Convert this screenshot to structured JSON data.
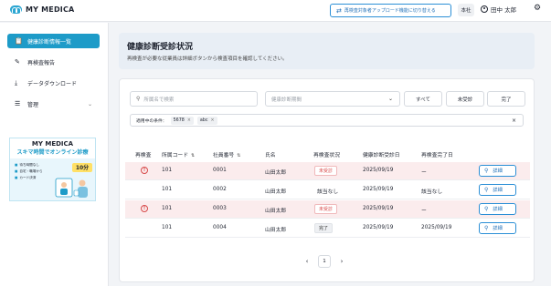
{
  "header": {
    "brand": "MY MEDICA",
    "switch_button": "再検査対象者アップロード機能に切り替える",
    "office": "本社",
    "user_name": "田中 太郎"
  },
  "sidebar": {
    "items": [
      {
        "label": "健康診断情報一覧",
        "icon": "clipboard-icon",
        "active": true
      },
      {
        "label": "再検査報告",
        "icon": "report-icon",
        "active": false
      },
      {
        "label": "データダウンロード",
        "icon": "download-icon",
        "active": false
      },
      {
        "label": "管理",
        "icon": "settings-icon",
        "active": false
      }
    ],
    "banner": {
      "brand": "MY MEDICA",
      "tagline": "スキマ時間でオンライン診療",
      "points": [
        "待ち時間なし",
        "自宅・職場から",
        "カード決済"
      ],
      "badge": "10分"
    }
  },
  "main": {
    "title": "健康診断受診状況",
    "description": "再検査が必要な従業員は詳細ボタンから検査項目を確認してください。",
    "search_placeholder": "所属名で検索",
    "period_placeholder": "健康診断期間",
    "segments": [
      "すべて",
      "未受診",
      "完了"
    ],
    "filter_label": "適用中の条件：",
    "chips": [
      "5678",
      "abc"
    ],
    "columns": [
      "再検査",
      "所属コード",
      "社員番号",
      "氏名",
      "再検査状況",
      "健康診断受診日",
      "再検査完了日"
    ],
    "rows": [
      {
        "alert": true,
        "dept": "101",
        "emp": "0001",
        "name": "山田太郎",
        "status": "未受診",
        "status_kind": "todo",
        "exam_date": "2025/09/19",
        "done_date": "ー",
        "action": "詳細"
      },
      {
        "alert": false,
        "dept": "101",
        "emp": "0002",
        "name": "山田太郎",
        "status": "該当なし",
        "status_kind": "none",
        "exam_date": "2025/09/19",
        "done_date": "該当なし",
        "action": "詳細"
      },
      {
        "alert": true,
        "dept": "101",
        "emp": "0003",
        "name": "山田太郎",
        "status": "未受診",
        "status_kind": "todo",
        "exam_date": "2025/09/19",
        "done_date": "ー",
        "action": "詳細"
      },
      {
        "alert": false,
        "dept": "101",
        "emp": "0004",
        "name": "山田太郎",
        "status": "完了",
        "status_kind": "done",
        "exam_date": "2025/09/19",
        "done_date": "2025/09/19",
        "action": "詳細"
      }
    ],
    "pagination": {
      "current": "1"
    }
  },
  "colors": {
    "accent": "#1d9bc8",
    "alert_row": "#fbeced",
    "danger": "#d84a4a",
    "link": "#2b8fd6"
  }
}
